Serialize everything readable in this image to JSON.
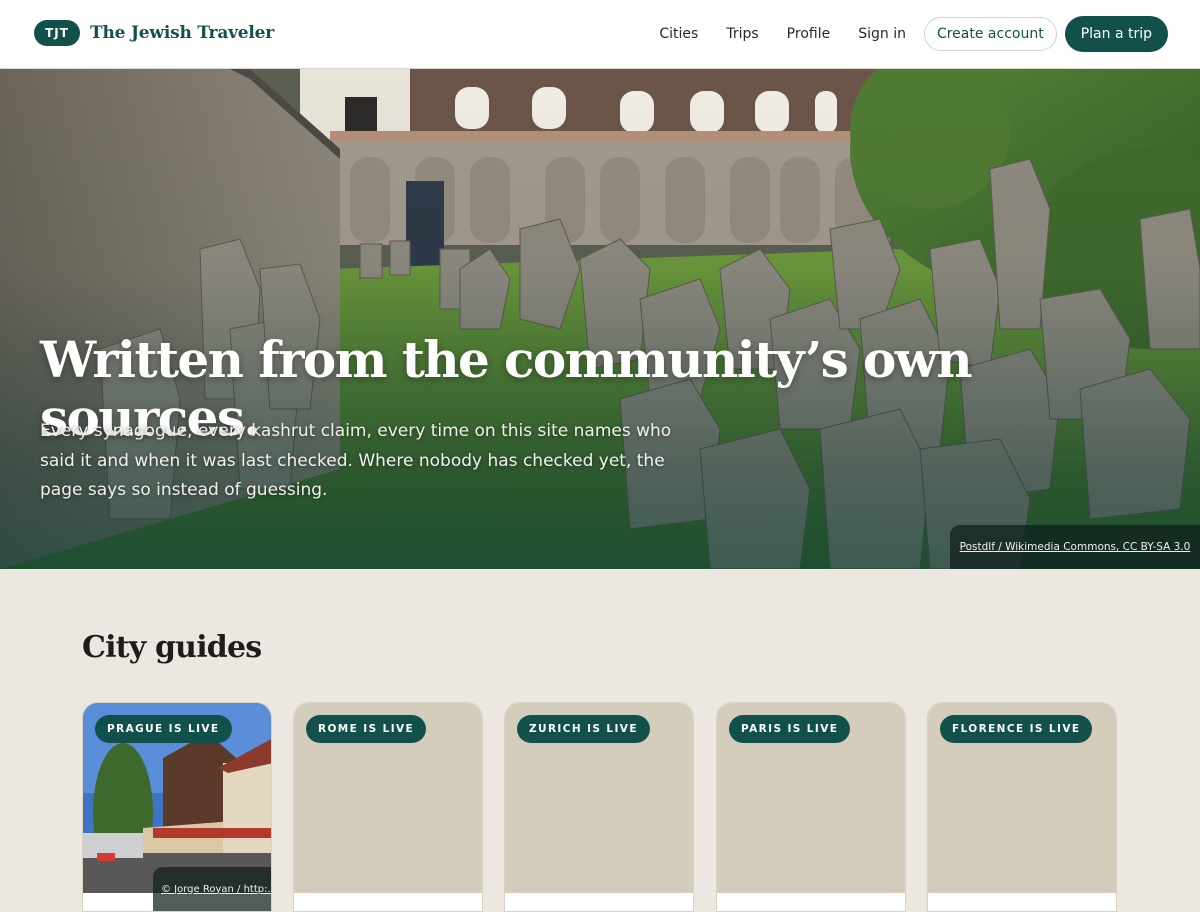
{
  "header": {
    "logo_badge": "TJT",
    "site_name": "The Jewish Traveler",
    "nav": [
      "Cities",
      "Trips",
      "Profile",
      "Sign in"
    ],
    "create_account": "Create account",
    "plan_trip": "Plan a trip"
  },
  "hero": {
    "title": "Written from the community’s own sources.",
    "subtitle": "Every synagogue, every kashrut claim, every time on this site names who said it and when it was last checked. Where nobody has checked yet, the page says so instead of guessing.",
    "image_credit": "Postdlf / Wikimedia Commons, CC BY-SA 3.0"
  },
  "city_guides": {
    "title": "City guides",
    "cards": [
      {
        "badge": "PRAGUE IS LIVE",
        "credit": "© Jorge Royan / http:..."
      },
      {
        "badge": "ROME IS LIVE"
      },
      {
        "badge": "ZURICH IS LIVE"
      },
      {
        "badge": "PARIS IS LIVE"
      },
      {
        "badge": "FLORENCE IS LIVE"
      }
    ]
  },
  "colors": {
    "brand": "#12514b",
    "page_bg": "#ece7e0",
    "card_placeholder": "#d5cdbc"
  }
}
